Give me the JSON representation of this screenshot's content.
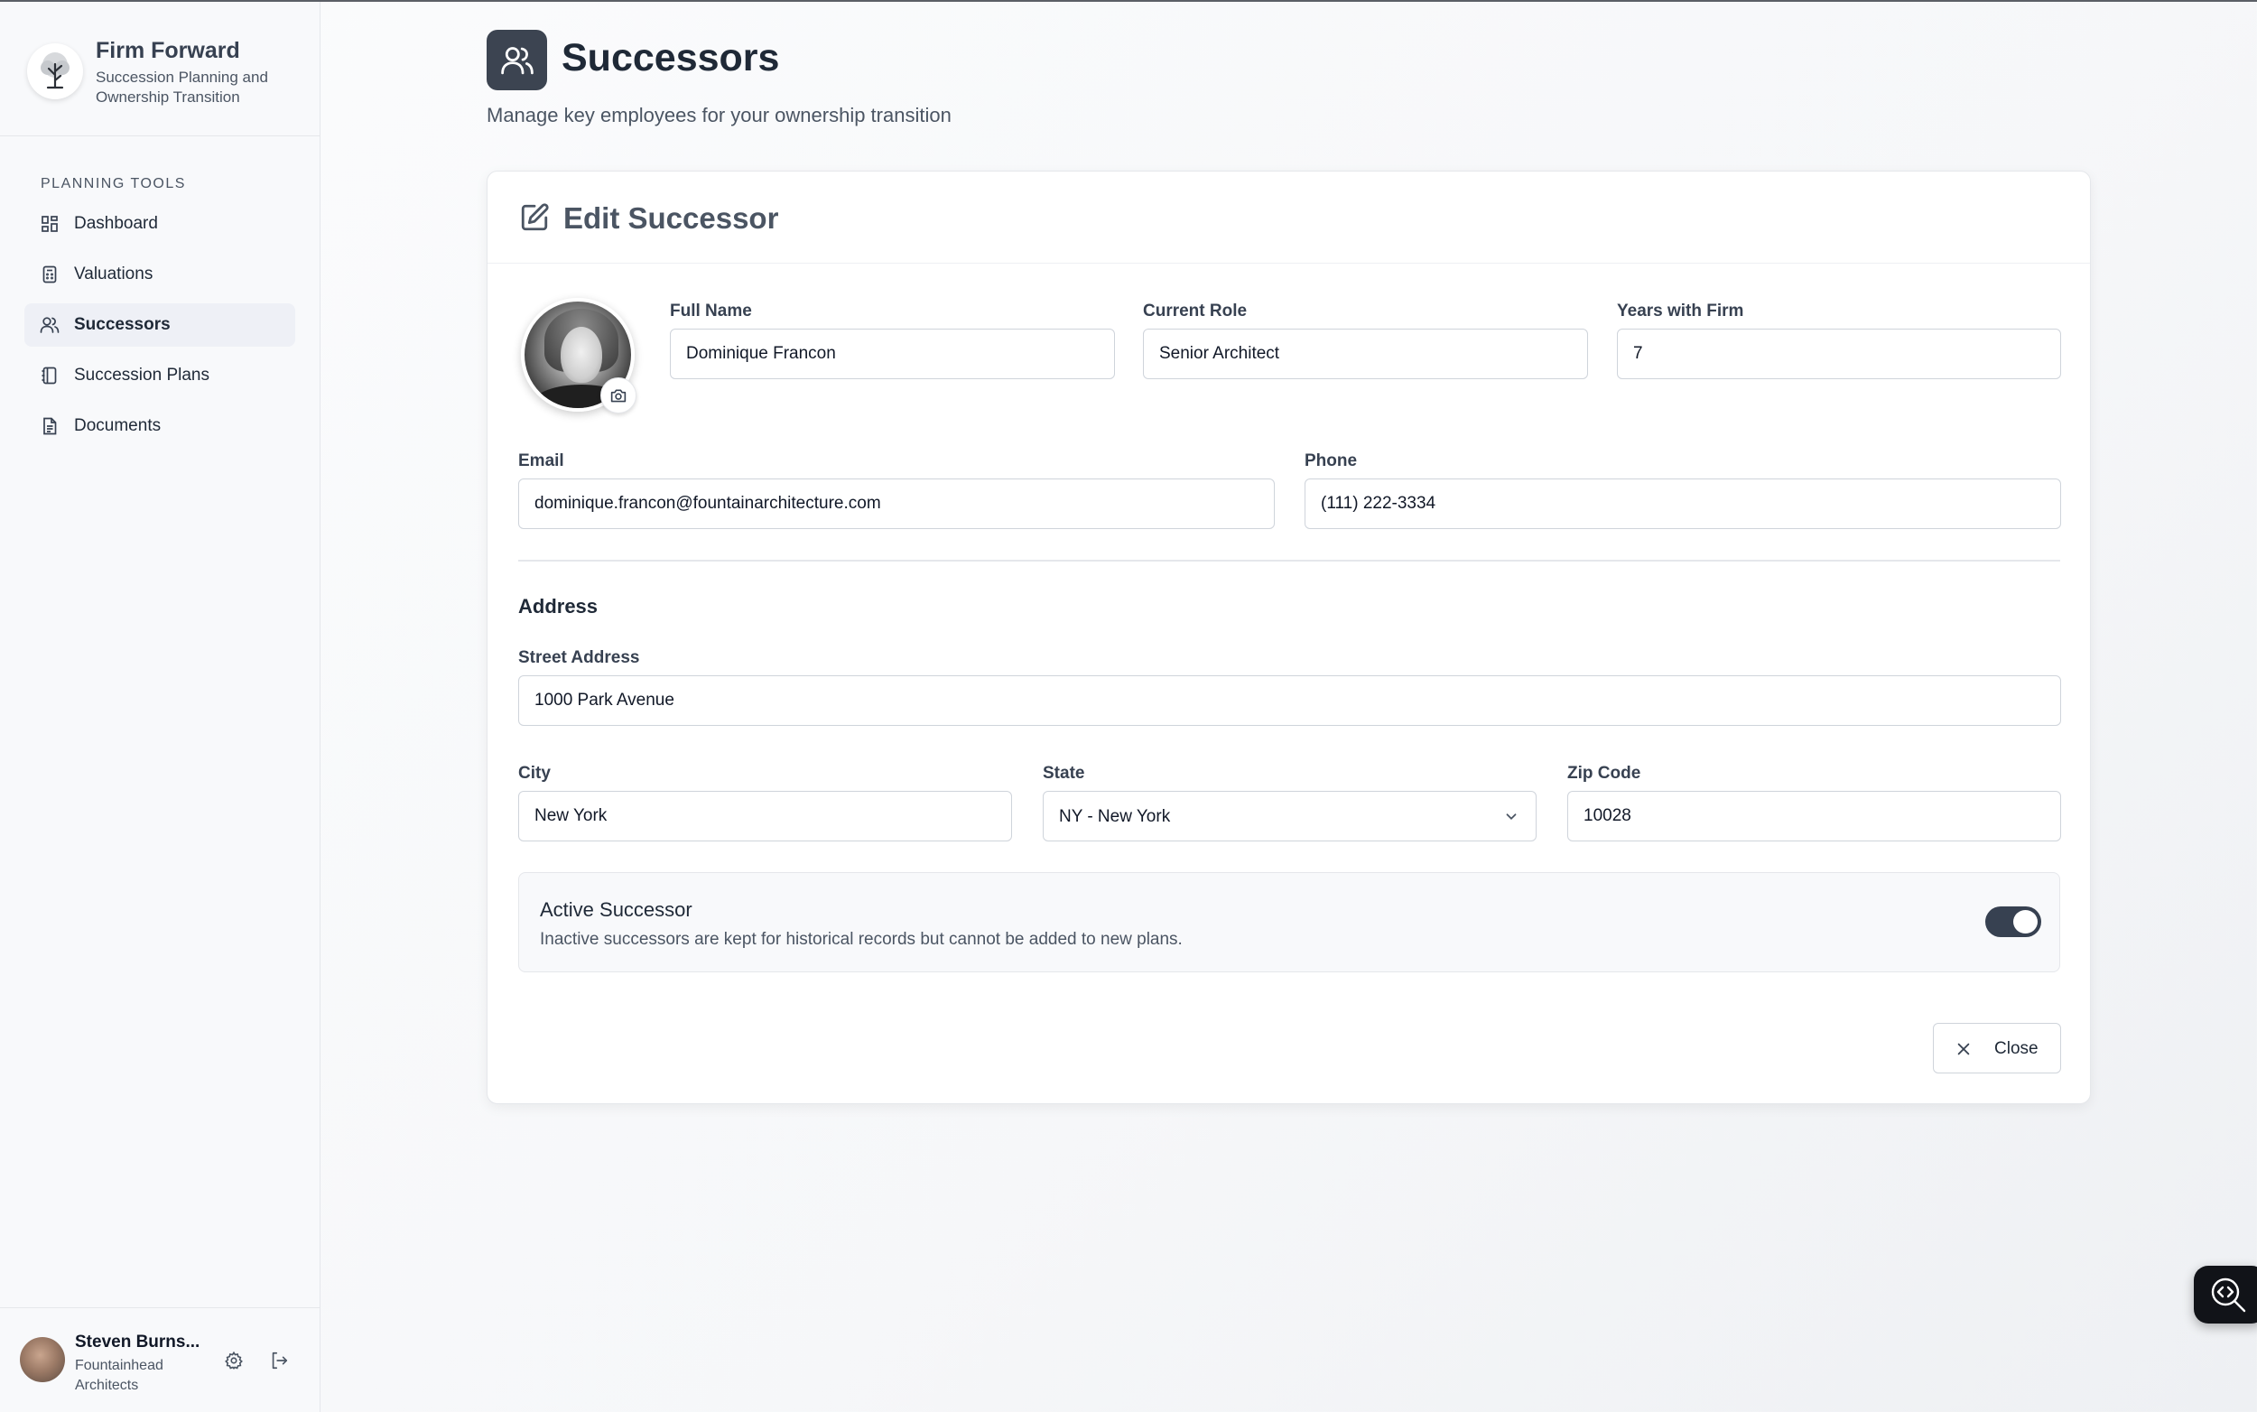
{
  "brand": {
    "name": "Firm Forward",
    "tagline": "Succession Planning and Ownership Transition",
    "logo_icon": "tree-icon"
  },
  "sidebar": {
    "section_label": "PLANNING TOOLS",
    "items": [
      {
        "label": "Dashboard",
        "icon": "dashboard-grid-icon",
        "active": false
      },
      {
        "label": "Valuations",
        "icon": "calculator-icon",
        "active": false
      },
      {
        "label": "Successors",
        "icon": "users-icon",
        "active": true
      },
      {
        "label": "Succession Plans",
        "icon": "notebook-icon",
        "active": false
      },
      {
        "label": "Documents",
        "icon": "document-icon",
        "active": false
      }
    ]
  },
  "user": {
    "name": "Steven Burns...",
    "org": "Fountainhead Architects",
    "settings_icon": "gear-icon",
    "logout_icon": "logout-icon"
  },
  "header": {
    "title": "Successors",
    "subtitle": "Manage key employees for your ownership transition",
    "icon": "users-icon"
  },
  "form": {
    "title": "Edit Successor",
    "title_icon": "edit-icon",
    "photo_icon": "camera-icon",
    "full_name": {
      "label": "Full Name",
      "value": "Dominique Francon"
    },
    "current_role": {
      "label": "Current Role",
      "value": "Senior Architect"
    },
    "years_with_firm": {
      "label": "Years with Firm",
      "value": "7"
    },
    "email": {
      "label": "Email",
      "value": "dominique.francon@fountainarchitecture.com"
    },
    "phone": {
      "label": "Phone",
      "value": "(111) 222-3334"
    },
    "address_title": "Address",
    "street": {
      "label": "Street Address",
      "value": "1000 Park Avenue"
    },
    "city": {
      "label": "City",
      "value": "New York"
    },
    "state": {
      "label": "State",
      "value": "NY - New York"
    },
    "zip": {
      "label": "Zip Code",
      "value": "10028"
    },
    "active": {
      "title": "Active Successor",
      "description": "Inactive successors are kept for historical records but cannot be added to new plans.",
      "enabled": true
    },
    "close_label": "Close"
  },
  "colors": {
    "accent": "#374151",
    "header_icon_bg": "#3c4451",
    "active_nav_bg": "#eef0f6"
  }
}
